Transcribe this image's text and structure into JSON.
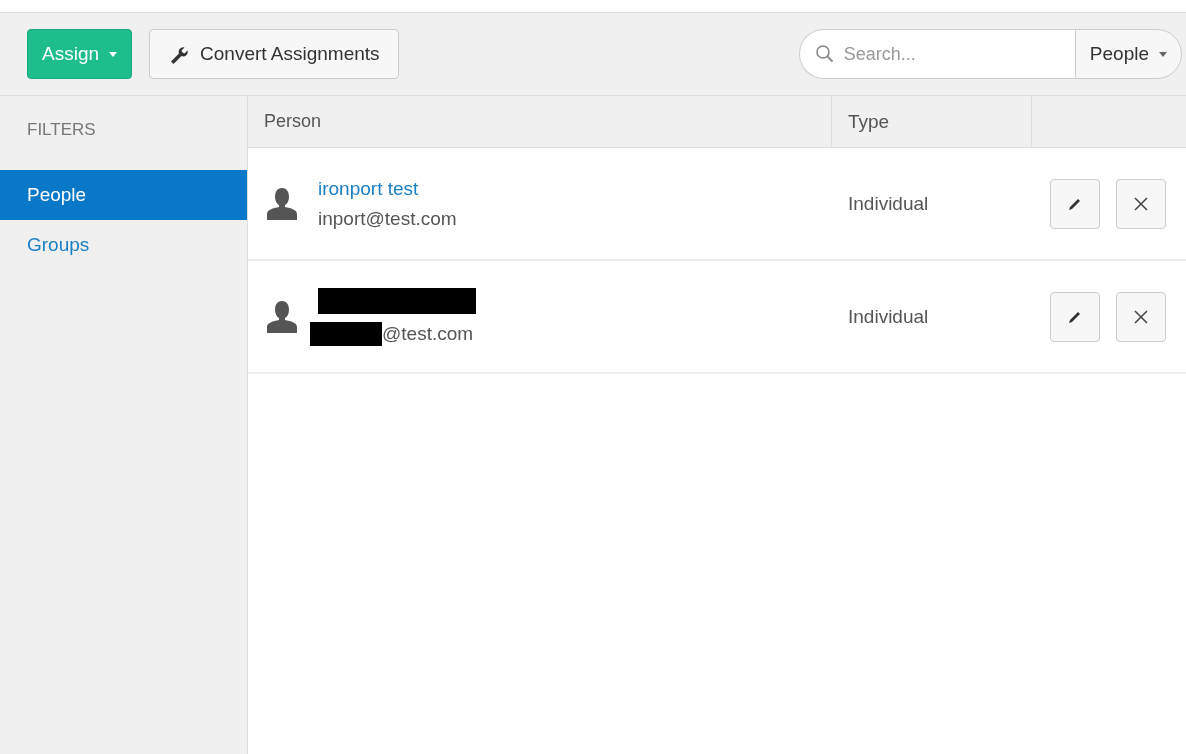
{
  "toolbar": {
    "assign_button": "Assign",
    "convert_button": "Convert Assignments",
    "search": {
      "placeholder": "Search..."
    },
    "scope_dropdown": "People"
  },
  "sidebar": {
    "heading": "FILTERS",
    "items": [
      {
        "label": "People",
        "selected": true
      },
      {
        "label": "Groups",
        "selected": false
      }
    ]
  },
  "table": {
    "columns": [
      "Person",
      "Type"
    ],
    "rows": [
      {
        "name": "ironport test",
        "name_redacted": false,
        "email": "inport@test.com",
        "email_redacted": false,
        "type": "Individual"
      },
      {
        "name_redacted": true,
        "email": "@test.com",
        "email_redacted": true,
        "type": "Individual"
      }
    ]
  }
}
